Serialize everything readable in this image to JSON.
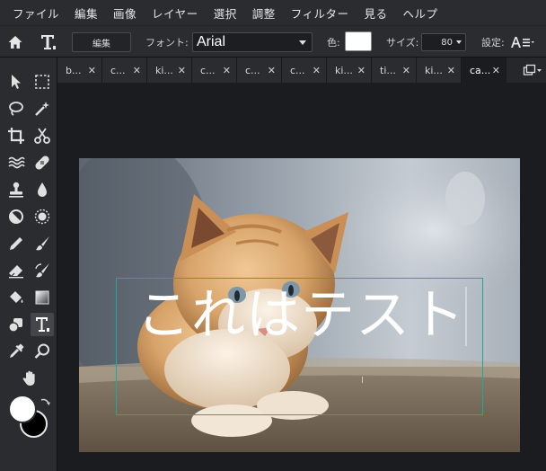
{
  "menu": [
    "ファイル",
    "編集",
    "画像",
    "レイヤー",
    "選択",
    "調整",
    "フィルター",
    "見る",
    "ヘルプ"
  ],
  "options": {
    "edit_label": "編集",
    "font_label": "フォント:",
    "font_value": "Arial",
    "color_label": "色:",
    "color_value": "#ffffff",
    "size_label": "サイズ:",
    "size_value": "80",
    "settings_label": "設定:"
  },
  "tabs": [
    "b...",
    "c...",
    "ki...",
    "c...",
    "c...",
    "c...",
    "ki...",
    "ti...",
    "ki...",
    "ca..."
  ],
  "active_tab": 9,
  "canvas": {
    "text": "これはテスト",
    "textbox_color": "#1fa8a0"
  },
  "colors": {
    "foreground": "#ffffff",
    "background": "#000000"
  },
  "icons": [
    "home-icon",
    "text-tool-icon",
    "align-settings-icon",
    "window-layout-icon"
  ]
}
